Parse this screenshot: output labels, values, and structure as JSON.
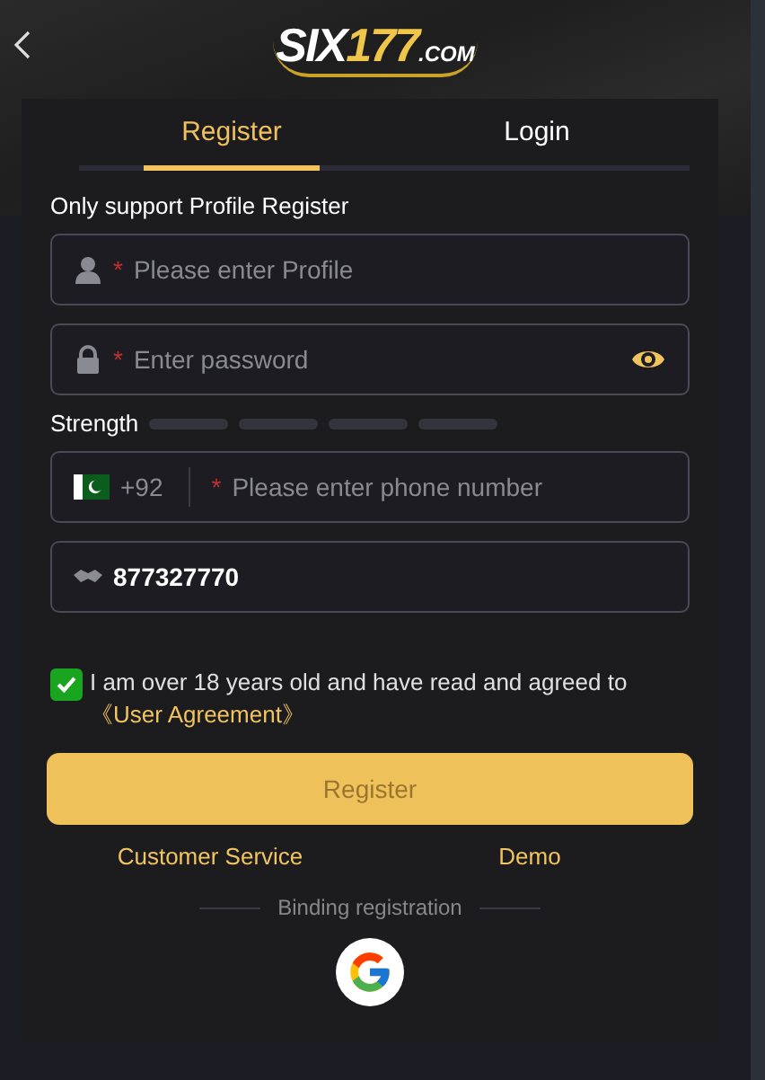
{
  "header": {
    "logo": {
      "text": "SIX",
      "accent": "177",
      "suffix": ".COM"
    }
  },
  "tabs": [
    {
      "label": "Register",
      "selected": true
    },
    {
      "label": "Login",
      "selected": false
    }
  ],
  "form": {
    "note": "Only support Profile Register",
    "profile": {
      "required_mark": "*",
      "placeholder": "Please enter Profile"
    },
    "password": {
      "required_mark": "*",
      "placeholder": "Enter password"
    },
    "strength": {
      "label": "Strength"
    },
    "phone": {
      "country_code": "+92",
      "required_mark": "*",
      "placeholder": "Please enter phone number"
    },
    "code": {
      "value": "877327770"
    },
    "agreement": {
      "checked": true,
      "text": "I am over 18 years old and have read and agreed to ",
      "link": "《User Agreement》"
    },
    "submit": "Register",
    "links": [
      "Customer Service",
      "Demo"
    ],
    "binding": "Binding registration"
  }
}
